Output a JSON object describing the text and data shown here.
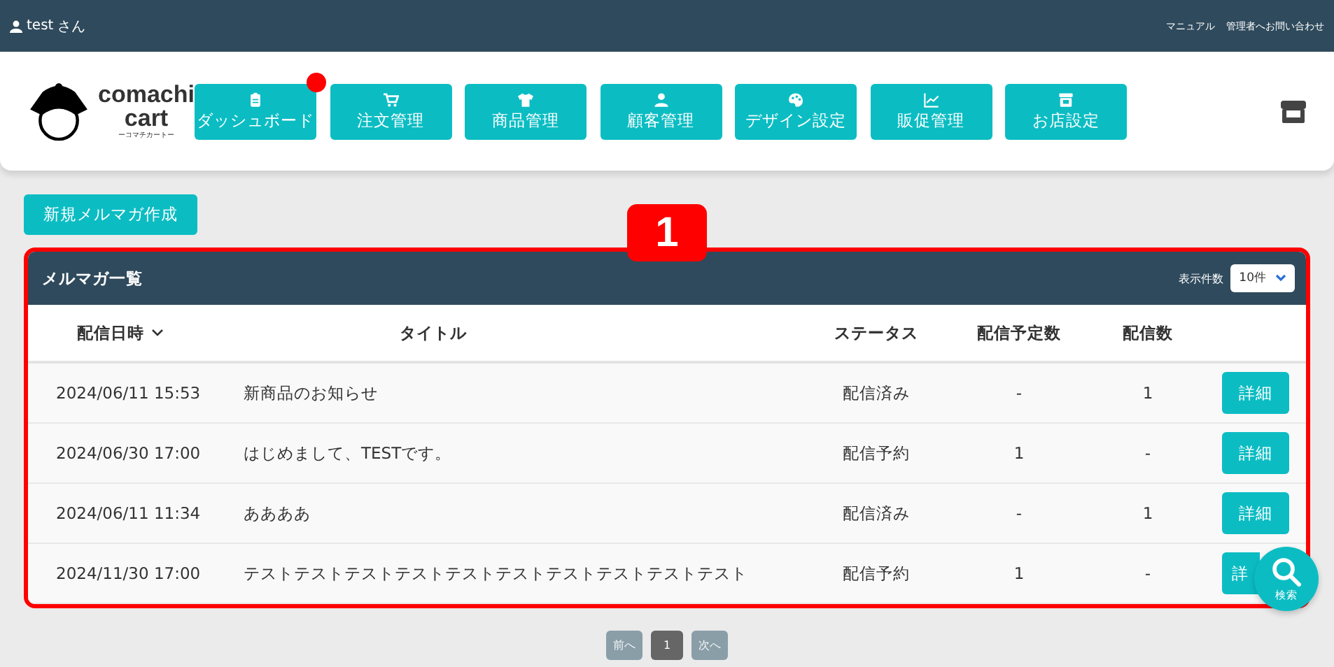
{
  "topbar": {
    "user": "test",
    "honorific": "さん",
    "links": [
      "マニュアル",
      "管理者へお問い合わせ"
    ]
  },
  "logo": {
    "name_line1": "comachi",
    "name_line2": "cart",
    "kana": "ーコマチカートー"
  },
  "nav": [
    {
      "label": "ダッシュボード",
      "notification": true
    },
    {
      "label": "注文管理",
      "notification": false
    },
    {
      "label": "商品管理",
      "notification": false
    },
    {
      "label": "顧客管理",
      "notification": false
    },
    {
      "label": "デザイン設定",
      "notification": false
    },
    {
      "label": "販促管理",
      "notification": false
    },
    {
      "label": "お店設定",
      "notification": false
    }
  ],
  "new_button": "新規メルマガ作成",
  "annotation": {
    "label": "1"
  },
  "panel": {
    "title": "メルマガ一覧",
    "page_size_label": "表示件数",
    "page_size_value": "10件",
    "columns": [
      {
        "label": "配信日時",
        "sorted": true
      },
      {
        "label": "タイトル",
        "sorted": false
      },
      {
        "label": "ステータス",
        "sorted": false
      },
      {
        "label": "配信予定数",
        "sorted": false
      },
      {
        "label": "配信数",
        "sorted": false
      }
    ],
    "rows": [
      {
        "date": "2024/06/11 15:53",
        "title": "新商品のお知らせ",
        "status": "配信済み",
        "scheduled": "-",
        "sent": "1",
        "action": "詳細"
      },
      {
        "date": "2024/06/30 17:00",
        "title": "はじめまして、TESTです。",
        "status": "配信予約",
        "scheduled": "1",
        "sent": "-",
        "action": "詳細"
      },
      {
        "date": "2024/06/11 11:34",
        "title": "ああああ",
        "status": "配信済み",
        "scheduled": "-",
        "sent": "1",
        "action": "詳細"
      },
      {
        "date": "2024/11/30 17:00",
        "title": "テストテストテストテストテストテストテストテストテストテスト",
        "status": "配信予約",
        "scheduled": "1",
        "sent": "-",
        "action": "詳"
      }
    ]
  },
  "pagination": [
    {
      "label": "前へ",
      "disabled": true,
      "selected": false
    },
    {
      "label": "1",
      "disabled": false,
      "selected": true
    },
    {
      "label": "次へ",
      "disabled": true,
      "selected": false
    }
  ],
  "search_fab": {
    "label": "検索"
  }
}
